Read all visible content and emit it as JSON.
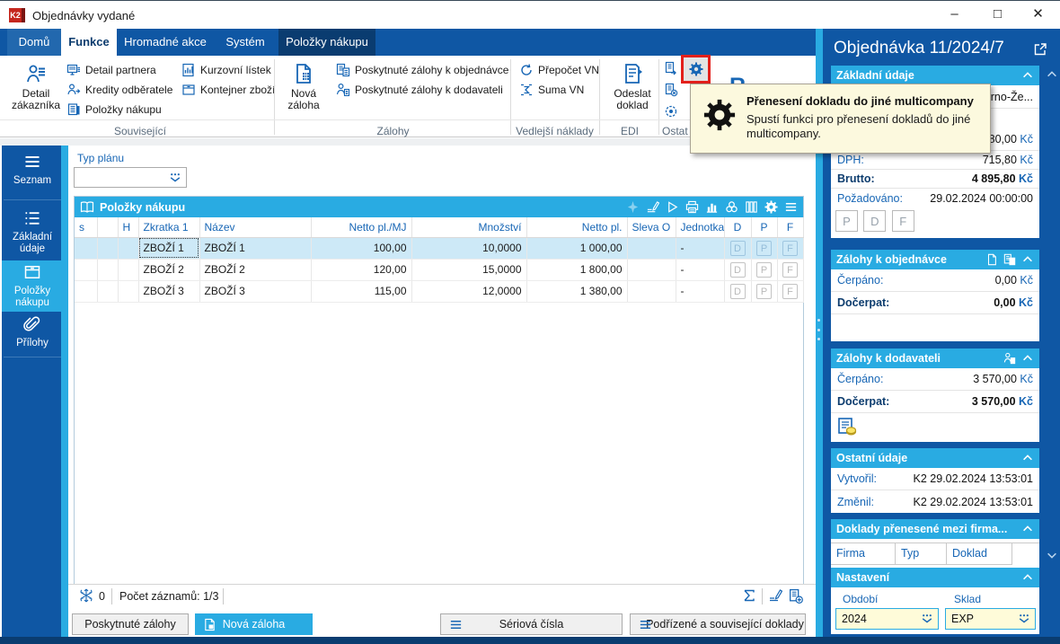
{
  "window": {
    "title": "Objednávky vydané",
    "logo_text": "K2"
  },
  "ribbon": {
    "tabs": [
      "Domů",
      "Funkce",
      "Hromadné akce",
      "Systém"
    ],
    "context_tab": "Položky nákupu",
    "groups": {
      "souvisejici": {
        "label": "Související",
        "big_button": "Detail zákazníka",
        "items": [
          "Detail partnera",
          "Kredity odběratele",
          "Položky nákupu",
          "Kurzovní lístek",
          "Kontejner zboží"
        ]
      },
      "zalohy": {
        "label": "Zálohy",
        "big_button": "Nová záloha",
        "items": [
          "Poskytnuté zálohy k objednávce",
          "Poskytnuté zálohy k dodavateli"
        ]
      },
      "vedlejsi": {
        "label": "Vedlejší náklady",
        "items": [
          "Přepočet VN",
          "Suma VN"
        ]
      },
      "edi": {
        "label": "EDI",
        "big_button": "Odeslat doklad"
      },
      "ostatni": {
        "label": "Ostat",
        "partial_button": "R"
      }
    }
  },
  "tooltip": {
    "title": "Přenesení dokladu do jiné multicompany",
    "line1": "Spustí funkci pro přenesení dokladů do jiné",
    "line2": "multicompany."
  },
  "sidebar": {
    "items": [
      "Seznam",
      "Základní údaje",
      "Položky nákupu",
      "Přílohy"
    ],
    "active": "Položky nákupu"
  },
  "content": {
    "plan_label": "Typ plánu",
    "table": {
      "title": "Položky nákupu",
      "columns": [
        "s",
        "",
        "H",
        "Zkratka 1",
        "Název",
        "Netto pl./MJ",
        "Množství",
        "Netto pl.",
        "Sleva O",
        "Jednotka",
        "D",
        "P",
        "F"
      ],
      "rows": [
        {
          "zkratka": "ZBOŽÍ 1",
          "nazev": "ZBOŽÍ 1",
          "netto_mj": "100,00",
          "mnozstvi": "10,0000",
          "netto": "1 000,00",
          "jednotka": "-"
        },
        {
          "zkratka": "ZBOŽÍ 2",
          "nazev": "ZBOŽÍ 2",
          "netto_mj": "120,00",
          "mnozstvi": "15,0000",
          "netto": "1 800,00",
          "jednotka": "-"
        },
        {
          "zkratka": "ZBOŽÍ 3",
          "nazev": "ZBOŽÍ 3",
          "netto_mj": "115,00",
          "mnozstvi": "12,0000",
          "netto": "1 380,00",
          "jednotka": "-"
        }
      ],
      "flag_letters": [
        "D",
        "P",
        "F"
      ]
    },
    "status": {
      "frozen": "0",
      "records": "Počet záznamů: 1/3"
    },
    "footer_buttons": [
      "Poskytnuté zálohy",
      "Nová záloha",
      "Sériová čísla",
      "Podřízené a související doklady"
    ]
  },
  "panel": {
    "title": "Objednávka 11/2024/7",
    "currency": "Kč",
    "zakladni": {
      "title": "Základní údaje",
      "partner_fragment": "rno-Že...",
      "netto_fragment": "80,00",
      "dph_label": "DPH:",
      "dph_value": "715,80",
      "brutto_label": "Brutto:",
      "brutto_value": "4 895,80",
      "pozadovano_label": "Požadováno:",
      "pozadovano_value": "29.02.2024 00:00:00",
      "flags": [
        "P",
        "D",
        "F"
      ]
    },
    "zalohy_objednavce": {
      "title": "Zálohy k objednávce",
      "cerpano_label": "Čerpáno:",
      "cerpano_value": "0,00",
      "docerpat_label": "Dočerpat:",
      "docerpat_value": "0,00"
    },
    "zalohy_dodavateli": {
      "title": "Zálohy k dodavateli",
      "cerpano_label": "Čerpáno:",
      "cerpano_value": "3 570,00",
      "docerpat_label": "Dočerpat:",
      "docerpat_value": "3 570,00"
    },
    "ostatni": {
      "title": "Ostatní údaje",
      "vytvoril_label": "Vytvořil:",
      "vytvoril_value": "K2 29.02.2024 13:53:01",
      "zmenil_label": "Změnil:",
      "zmenil_value": "K2 29.02.2024 13:53:01"
    },
    "doklady": {
      "title": "Doklady přenesené mezi firma...",
      "columns": [
        "Firma",
        "Typ",
        "Doklad"
      ]
    },
    "nastaveni": {
      "title": "Nastavení",
      "obdobi_label": "Období",
      "obdobi_value": "2024",
      "sklad_label": "Sklad",
      "sklad_value": "EXP"
    }
  }
}
